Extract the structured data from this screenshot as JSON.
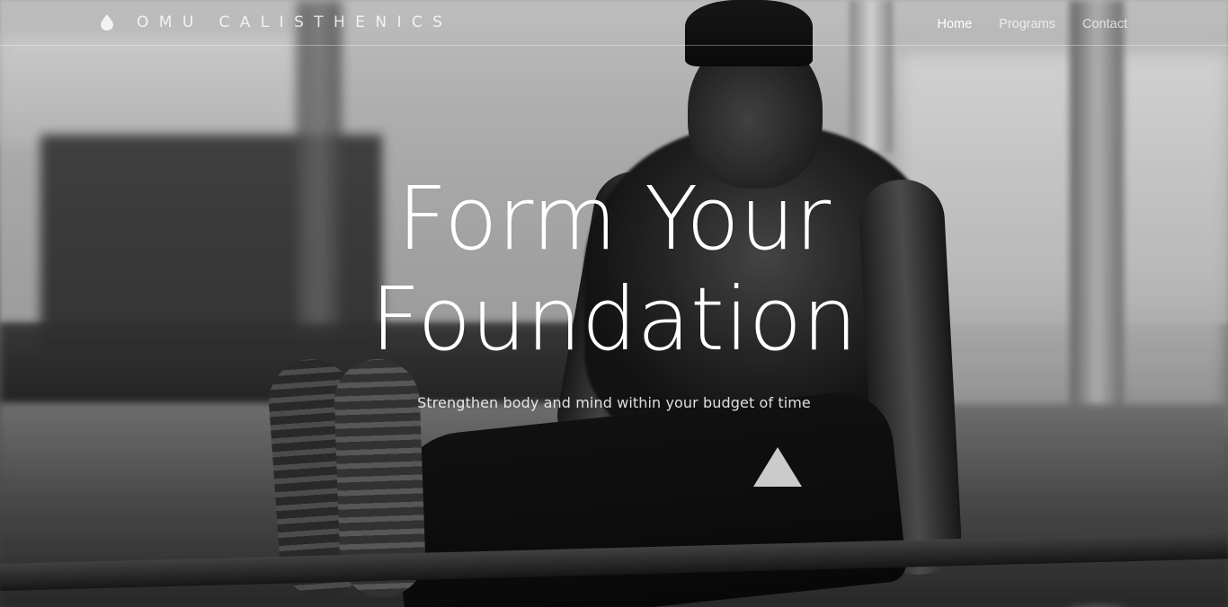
{
  "brand": {
    "name": "OMU CALISTHENICS",
    "icon": "water-drop-icon"
  },
  "nav": {
    "items": [
      {
        "label": "Home",
        "active": true
      },
      {
        "label": "Programs",
        "active": false
      },
      {
        "label": "Contact",
        "active": false
      }
    ]
  },
  "hero": {
    "title_line_1": "Form Your",
    "title_line_2": "Foundation",
    "subtitle": "Strengthen body and mind within your budget of time",
    "background": "black-and-white photo of an athlete holding an L-sit on parallel bars"
  },
  "colors": {
    "text": "#ffffff",
    "nav_inactive": "#cfcfcf",
    "divider": "#ffffff"
  }
}
